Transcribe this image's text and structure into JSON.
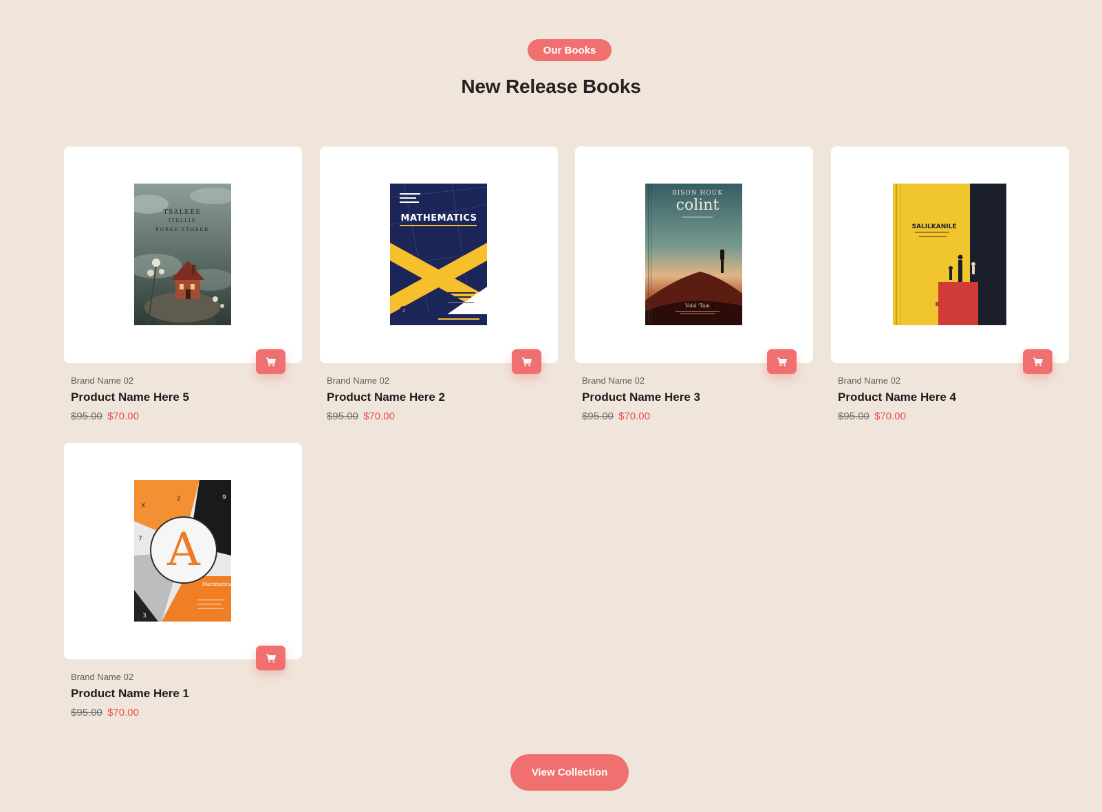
{
  "section": {
    "badge": "Our Books",
    "title": "New Release Books",
    "view_button": "View Collection"
  },
  "products": [
    {
      "brand": "Brand Name 02",
      "name": "Product Name Here 5",
      "old_price": "$95.00",
      "new_price": "$70.00",
      "cover_text": [
        "TSALKEE",
        "ITELLIE",
        "FORKE STHEER"
      ]
    },
    {
      "brand": "Brand Name 02",
      "name": "Product Name Here 2",
      "old_price": "$95.00",
      "new_price": "$70.00",
      "cover_text": [
        "MATHEMATICS"
      ]
    },
    {
      "brand": "Brand Name 02",
      "name": "Product Name Here 3",
      "old_price": "$95.00",
      "new_price": "$70.00",
      "cover_text": [
        "BISON HOUK",
        "colint",
        "Volsl 'Tain"
      ]
    },
    {
      "brand": "Brand Name 02",
      "name": "Product Name Here 4",
      "old_price": "$95.00",
      "new_price": "$70.00",
      "cover_text": [
        "SALILKANILE"
      ]
    },
    {
      "brand": "Brand Name 02",
      "name": "Product Name Here 1",
      "old_price": "$95.00",
      "new_price": "$70.00",
      "cover_text": [
        "A",
        "Mathmatica"
      ]
    }
  ],
  "colors": {
    "background": "#f0e5da",
    "accent": "#f07070",
    "sale_price": "#ee4e4e"
  },
  "icons": {
    "cart": "shopping-cart-icon"
  }
}
